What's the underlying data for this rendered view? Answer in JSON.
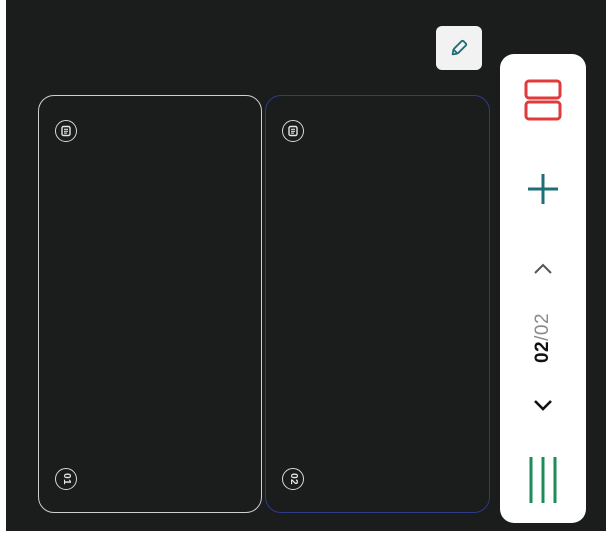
{
  "cards": [
    {
      "number_label": "01",
      "selected": false,
      "border_color": "#cfcfcf"
    },
    {
      "number_label": "02",
      "selected": true,
      "border_color": "#2f3a8a"
    }
  ],
  "toolbar": {
    "page_current": "02",
    "page_separator": "/",
    "page_total": "02",
    "icons": {
      "edit": "pencil-icon",
      "layout": "split-layout-icon",
      "add": "plus-icon",
      "prev": "chevron-up-icon",
      "next": "chevron-down-icon",
      "menu": "vertical-bars-icon"
    }
  },
  "colors": {
    "background": "#1b1c1c",
    "layout_red": "#e03a3a",
    "add_teal": "#1e6f78",
    "menu_green": "#1f8a5a",
    "selected_border": "#2f3a8a"
  }
}
